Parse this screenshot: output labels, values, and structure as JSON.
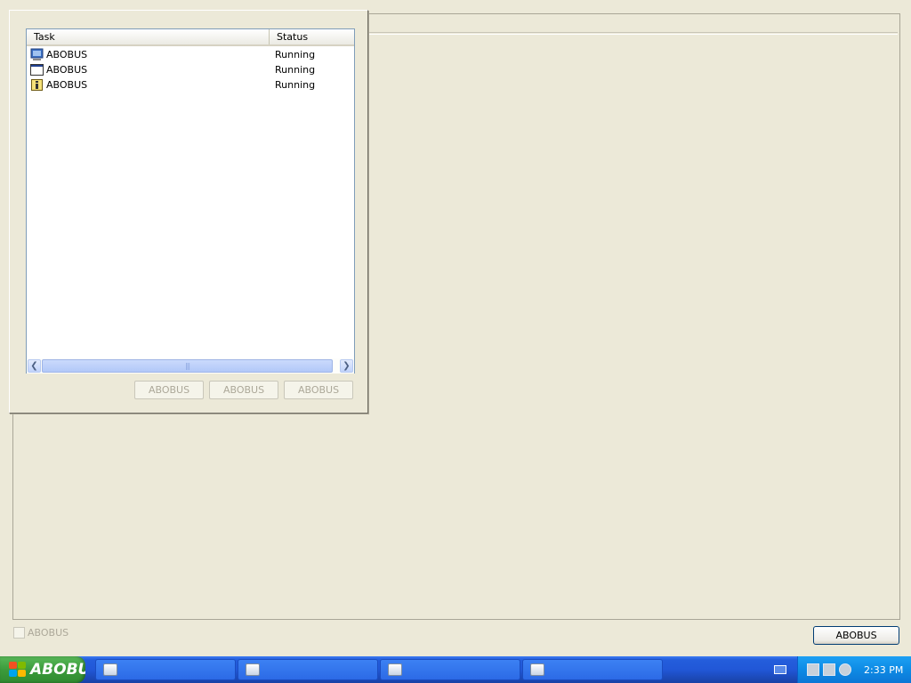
{
  "task_panel": {
    "columns": [
      "Task",
      "Status"
    ],
    "rows": [
      {
        "icon": "computer-icon",
        "name": "ABOBUS",
        "status": "Running"
      },
      {
        "icon": "window-icon",
        "name": "ABOBUS",
        "status": "Running"
      },
      {
        "icon": "info-icon",
        "name": "ABOBUS",
        "status": "Running"
      }
    ],
    "scroll_grip": "|||",
    "buttons": [
      "ABOBUS",
      "ABOBUS",
      "ABOBUS"
    ]
  },
  "main": {
    "checkbox_label": "ABOBUS",
    "button_label": "ABOBUS"
  },
  "taskbar": {
    "start_label": "ABOBUS",
    "items": [
      {
        "icon": "folder-icon"
      },
      {
        "icon": "window-icon"
      },
      {
        "icon": "computer-icon"
      },
      {
        "icon": "computer-icon"
      }
    ],
    "clock": "2:33 PM"
  },
  "colors": {
    "desktop": "#ECE9D8",
    "taskbar": "#245EDC",
    "start": "#3C9B3C",
    "tray": "#0E8BE5"
  }
}
